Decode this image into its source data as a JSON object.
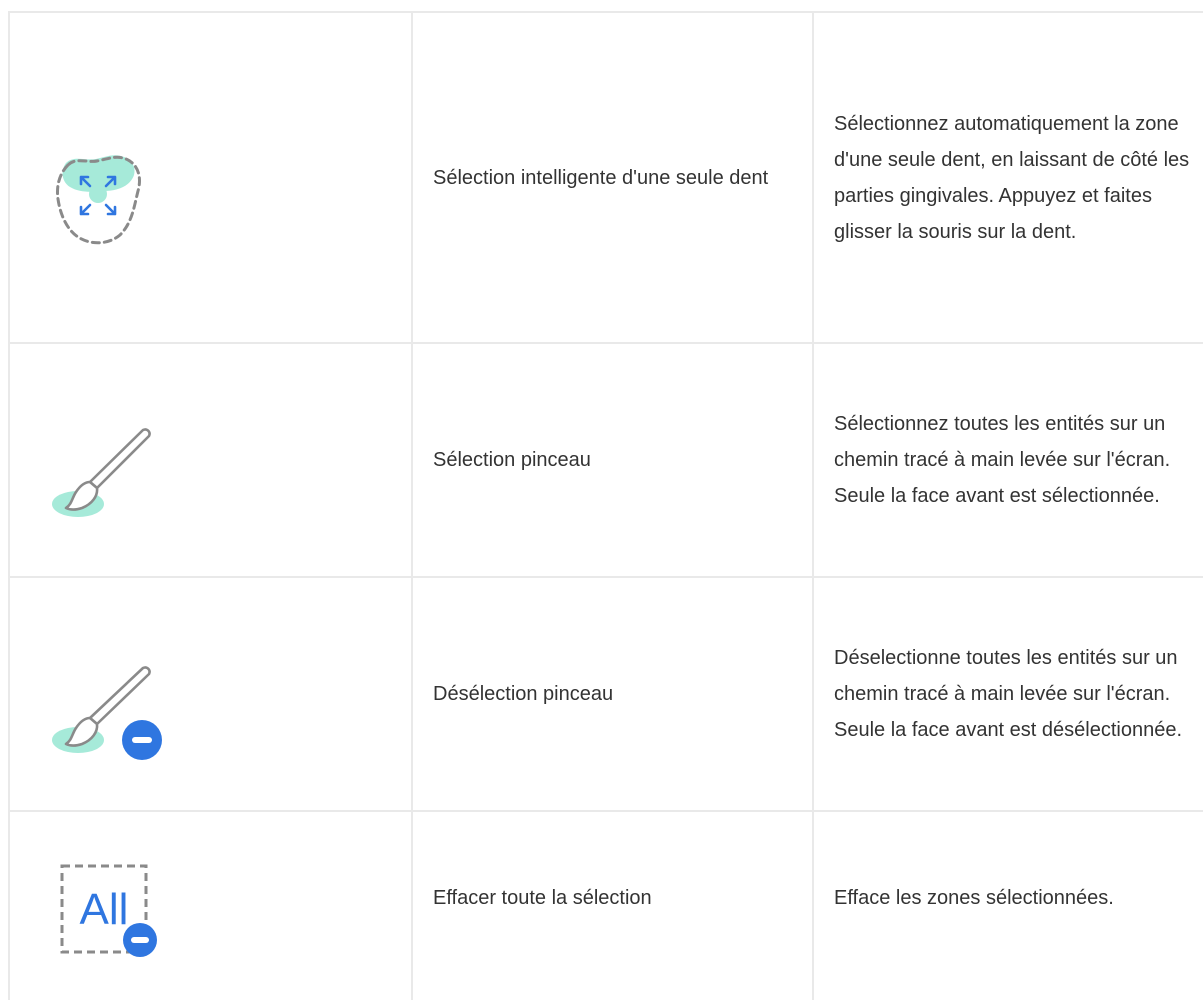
{
  "colors": {
    "mint": "#a6ead9",
    "blue": "#2f76e0",
    "gray": "#8a8a8a",
    "border": "#e9e9e9",
    "text": "#333333"
  },
  "rows": [
    {
      "icon": "smart-tooth-selection-icon",
      "name": "Sélection intelligente d'une seule dent",
      "description": "Sélectionnez automatiquement la zone d'une seule dent, en laissant de côté les parties gingivales. Appuyez et faites glisser la souris sur la dent."
    },
    {
      "icon": "brush-select-icon",
      "name": "Sélection pinceau",
      "description": "Sélectionnez toutes les entités sur un chemin tracé à main levée sur l'écran. Seule la face avant est sélectionnée."
    },
    {
      "icon": "brush-deselect-icon",
      "name": "Désélection pinceau",
      "description": "Déselectionne toutes les entités sur un chemin tracé à main levée sur l'écran. Seule la face avant est désélectionnée."
    },
    {
      "icon": "clear-all-selection-icon",
      "name": "Effacer toute la sélection",
      "description": "Efface les zones sélectionnées.",
      "icon_text": "All"
    }
  ]
}
